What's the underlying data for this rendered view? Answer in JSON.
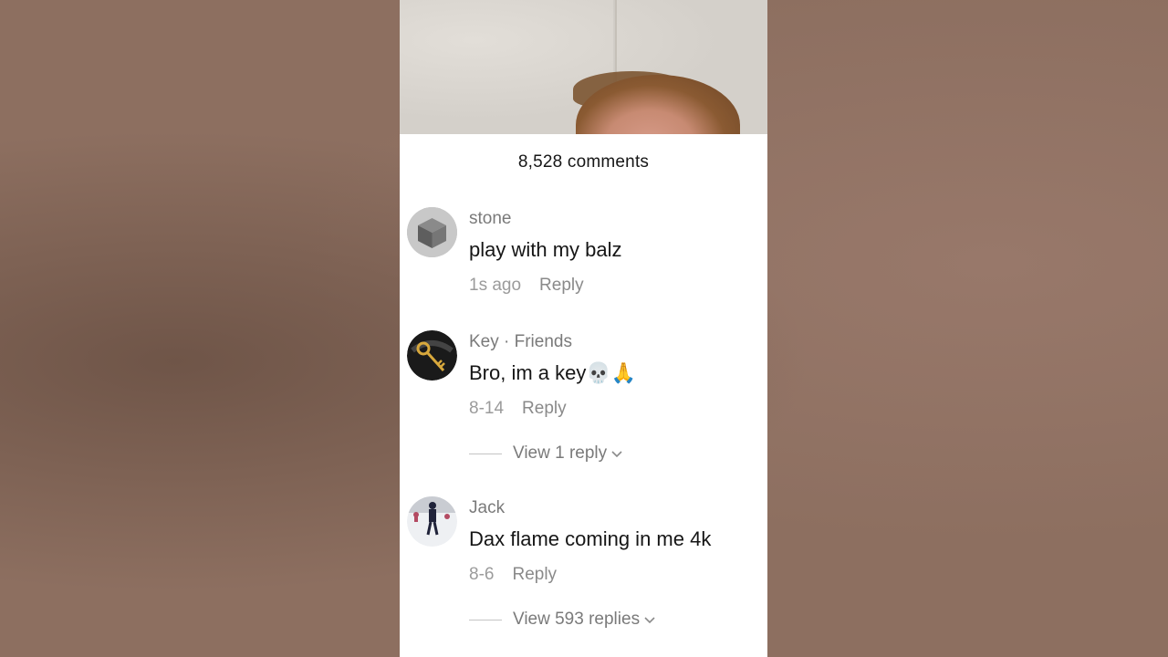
{
  "comments_header": {
    "count_label": "8,528 comments"
  },
  "comments": [
    {
      "username": "stone",
      "text": "play with my balz",
      "time": "1s ago",
      "reply_label": "Reply",
      "avatar_icon": "stone-block-avatar"
    },
    {
      "username": "Key · Friends",
      "text": "Bro, im a key💀🙏",
      "time": "8-14",
      "reply_label": "Reply",
      "view_replies": "View 1 reply",
      "avatar_icon": "golden-key-avatar"
    },
    {
      "username": "Jack",
      "text": "Dax flame coming in me 4k",
      "time": "8-6",
      "reply_label": "Reply",
      "view_replies": "View 593 replies",
      "avatar_icon": "snow-skater-avatar"
    }
  ],
  "colors": {
    "background": "#8d6f60",
    "sheet": "#ffffff",
    "text_primary": "#161616",
    "text_secondary": "#7a7a7a"
  }
}
